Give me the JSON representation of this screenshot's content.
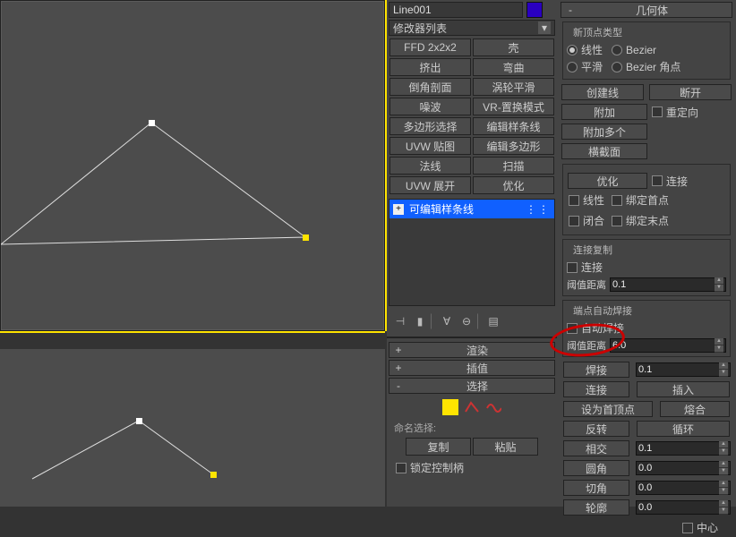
{
  "object_name": "Line001",
  "modlist_label": "修改器列表",
  "modifiers": [
    [
      "FFD 2x2x2",
      "壳"
    ],
    [
      "挤出",
      "弯曲"
    ],
    [
      "倒角剖面",
      "涡轮平滑"
    ],
    [
      "噪波",
      "VR-置换模式"
    ],
    [
      "多边形选择",
      "编辑样条线"
    ],
    [
      "UVW 贴图",
      "编辑多边形"
    ],
    [
      "法线",
      "扫描"
    ],
    [
      "UVW 展开",
      "优化"
    ]
  ],
  "stack_item": "可编辑样条线",
  "rollouts": {
    "render": "渲染",
    "interp": "插值",
    "select": "选择"
  },
  "named_sel_label": "命名选择:",
  "named_sel_copy": "复制",
  "named_sel_paste": "粘贴",
  "lock_handle": "锁定控制柄",
  "geom_header": "几何体",
  "new_vertex_type": "新顶点类型",
  "rb_linear": "线性",
  "rb_bezier": "Bezier",
  "rb_smooth": "平滑",
  "rb_bezcorner": "Bezier 角点",
  "btn_createline": "创建线",
  "btn_break": "断开",
  "btn_attach": "附加",
  "btn_attachmulti": "附加多个",
  "chk_reorient": "重定向",
  "btn_crosssection": "横截面",
  "btn_optimize": "优化",
  "chk_connect": "连接",
  "chk_linear2": "线性",
  "chk_bindfirst": "绑定首点",
  "chk_close": "闭合",
  "chk_bindlast": "绑定末点",
  "grp_connectcopy": "连接复制",
  "chk_connect2": "连接",
  "lbl_threshold": "阈值距离",
  "val_threshold1": "0.1",
  "grp_autoweld": "端点自动焊接",
  "chk_autoweld": "自动焊接",
  "val_threshold2": "6.0",
  "btn_weld": "焊接",
  "val_weld": "0.1",
  "btn_connect3": "连接",
  "btn_insert": "插入",
  "btn_setfirst": "设为首顶点",
  "btn_fuse": "熔合",
  "btn_reverse": "反转",
  "btn_cycle": "循环",
  "btn_cross": "相交",
  "val_cross": "0.1",
  "btn_fillet": "圆角",
  "val_fillet": "0.0",
  "btn_chamfer": "切角",
  "val_chamfer": "0.0",
  "btn_outline": "轮廓",
  "val_outline": "0.0",
  "chk_center": "中心"
}
